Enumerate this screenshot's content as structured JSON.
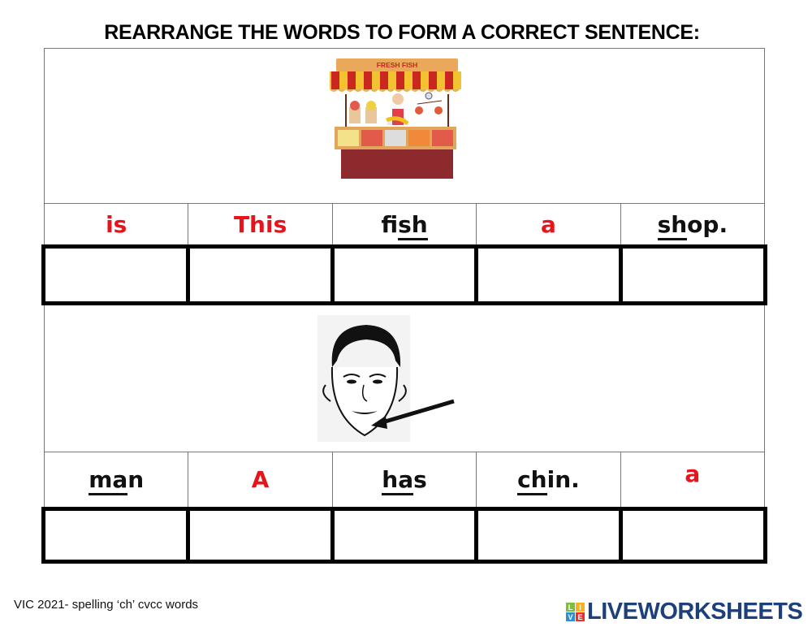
{
  "title": "REARRANGE THE WORDS TO FORM A CORRECT SENTENCE:",
  "exercises": [
    {
      "image": "fish-shop-stall-image",
      "image_sign": "FRESH FISH",
      "words": [
        {
          "text": "is",
          "color": "red",
          "underline": ""
        },
        {
          "text": "This",
          "color": "red",
          "underline": ""
        },
        {
          "pre": "fi",
          "u": "sh",
          "post": "",
          "color": "black"
        },
        {
          "text": "a",
          "color": "red",
          "underline": ""
        },
        {
          "pre": "",
          "u": "sh",
          "post": "op.",
          "color": "black"
        }
      ],
      "answers": [
        "",
        "",
        "",
        "",
        ""
      ]
    },
    {
      "image": "man-face-chin-arrow-image",
      "words": [
        {
          "pre": "",
          "u": "ma",
          "post": "n",
          "color": "black"
        },
        {
          "text": "A",
          "color": "red"
        },
        {
          "pre": "",
          "u": "ha",
          "post": "s",
          "color": "black"
        },
        {
          "pre": "",
          "u": "ch",
          "post": "in.",
          "color": "black"
        },
        {
          "text": "a",
          "color": "red"
        }
      ],
      "answers": [
        "",
        "",
        "",
        "",
        ""
      ]
    }
  ],
  "footer": {
    "caption": "VIC 2021- spelling ‘ch’ cvcc words",
    "logo_text": "LIVEWORKSHEETS",
    "logo_tiles": [
      "L",
      "I",
      "V",
      "E"
    ],
    "logo_colors": [
      "#7bbf3a",
      "#f5b21b",
      "#2a8fd6",
      "#e8302f"
    ]
  },
  "colors": {
    "accent_red": "#e8141b",
    "logo_blue": "#1d3f7a"
  }
}
